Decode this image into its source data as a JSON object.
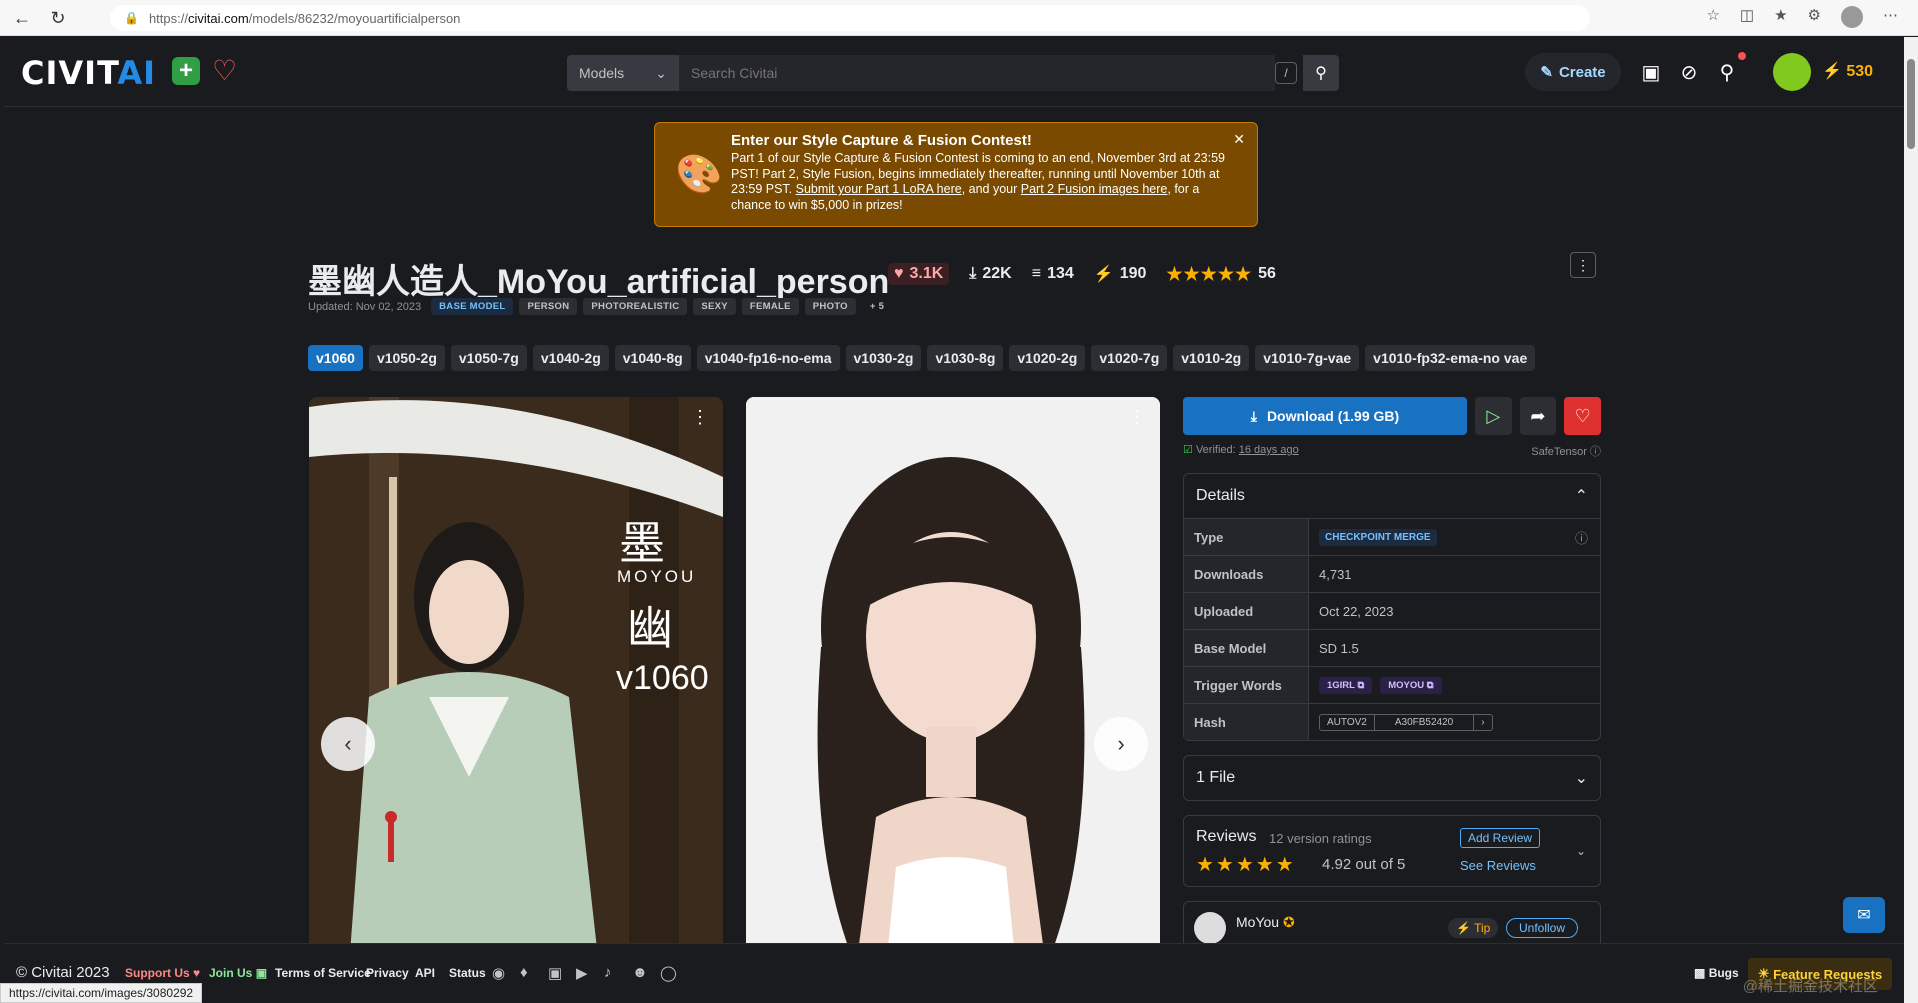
{
  "browser": {
    "url_prefix": "https://",
    "url_host": "civitai.com",
    "url_path": "/models/86232/moyouartificialperson",
    "status_url": "https://civitai.com/images/3080292"
  },
  "header": {
    "logo_civ": "CIVIT",
    "logo_ai": "AI",
    "search_category": "Models",
    "search_placeholder": "Search Civitai",
    "search_shortcut": "/",
    "create_label": "Create",
    "buzz_amount": "530"
  },
  "banner": {
    "title": "Enter our Style Capture & Fusion Contest!",
    "body_1": "Part 1 of our Style Capture & Fusion Contest is coming to an end, November 3rd at 23:59 PST! Part 2, Style Fusion, begins immediately thereafter, running until November 10th at 23:59 PST. ",
    "link_1": "Submit your Part 1 LoRA here",
    "body_2": ", and your ",
    "link_2": "Part 2 Fusion images here",
    "body_3": ", for a chance to win $5,000 in prizes!"
  },
  "model": {
    "title": "墨幽人造人_MoYou_artificial_person",
    "likes": "3.1K",
    "downloads": "22K",
    "collections": "134",
    "buzz": "190",
    "rating_count": "56",
    "updated": "Updated: Nov 02, 2023",
    "tags": [
      "BASE MODEL",
      "PERSON",
      "PHOTOREALISTIC",
      "SEXY",
      "FEMALE",
      "PHOTO",
      "+ 5"
    ],
    "versions": [
      "v1060",
      "v1050-2g",
      "v1050-7g",
      "v1040-2g",
      "v1040-8g",
      "v1040-fp16-no-ema",
      "v1030-2g",
      "v1030-8g",
      "v1020-2g",
      "v1020-7g",
      "v1010-2g",
      "v1010-7g-vae",
      "v1010-fp32-ema-no vae"
    ],
    "image_text_1": "墨",
    "image_text_2": "MOYOU",
    "image_text_3": "幽",
    "image_text_4": "v1060"
  },
  "panel": {
    "download_label": "Download (1.99 GB)",
    "verified_prefix": "Verified: ",
    "verified_date": "16 days ago",
    "file_format": "SafeTensor",
    "details_title": "Details",
    "details": [
      {
        "k": "Type",
        "v": "CHECKPOINT MERGE"
      },
      {
        "k": "Downloads",
        "v": "4,731"
      },
      {
        "k": "Uploaded",
        "v": "Oct 22, 2023"
      },
      {
        "k": "Base Model",
        "v": "SD 1.5"
      },
      {
        "k": "Trigger Words",
        "v": ""
      },
      {
        "k": "Hash",
        "v": ""
      }
    ],
    "trigger_words": [
      "1GIRL",
      "MOYOU"
    ],
    "hash_type": "AUTOV2",
    "hash_value": "A30FB52420",
    "files_label": "1 File",
    "reviews_title": "Reviews",
    "reviews_count": "12 version ratings",
    "reviews_score": "4.92 out of 5",
    "add_review": "Add Review",
    "see_reviews": "See Reviews",
    "creator_name": "MoYou",
    "tip_label": "Tip",
    "unfollow_label": "Unfollow"
  },
  "footer": {
    "copyright": "© Civitai 2023",
    "support": "Support Us",
    "join": "Join Us",
    "tos": "Terms of Service",
    "privacy": "Privacy",
    "api": "API",
    "status": "Status",
    "bugs": "Bugs",
    "feature_requests": "Feature Requests"
  },
  "watermark": "@稀土掘金技术社区",
  "colors": {
    "accent": "#1971c2",
    "background": "#1a1b1e",
    "banner": "#7a4a00",
    "star": "#fab005",
    "like": "#fa5252"
  }
}
